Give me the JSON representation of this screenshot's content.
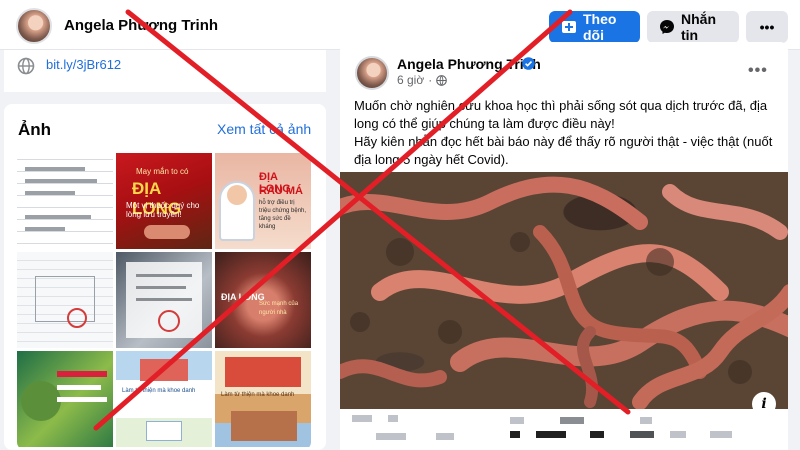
{
  "profile": {
    "name": "Angela Phương Trinh",
    "follow_label": "Theo dõi",
    "message_label": "Nhắn tin",
    "more_label": "•••"
  },
  "intro": {
    "link": "bit.ly/3jBr612"
  },
  "photos": {
    "title": "Ảnh",
    "see_all": "Xem tất cả ảnh",
    "tiles": [
      {
        "lines": []
      },
      {
        "heading": "ĐỊA LONG",
        "top": "May mắn to có",
        "sub": "Một vị thuốc quý cho lòng lưu truyền!"
      },
      {
        "heading": "ĐỊA LONG",
        "heading2": "RAU MÁ",
        "sub": "hỗ trợ điều trị triệu chứng bệnh, tăng sức đề kháng"
      },
      {
        "lines": []
      },
      {
        "lines": []
      },
      {
        "heading": "ĐỊA LONG",
        "sub": "Sức mạnh của người nhà"
      },
      {
        "lines": []
      },
      {
        "sub": "Làm từ thiện mà khoe danh"
      },
      {
        "sub": "Làm từ thiện mà khoe danh"
      }
    ]
  },
  "post": {
    "author": "Angela Phương Trinh",
    "time": "6 giờ",
    "text_lines": [
      "Muốn chờ nghiên cứu khoa học thì phải sống sót qua dịch trước đã, địa",
      "long có thể giúp chúng ta làm được điều này!",
      "Hãy kiên nhẫn đọc hết bài báo này để thấy rõ người thật - việc thật (nuốt",
      "địa long 5 ngày hết Covid)."
    ],
    "info_label": "i"
  },
  "colors": {
    "accent": "#1b74e4",
    "link": "#216fdb",
    "cross": "#e21e26",
    "bg": "#f0f2f5"
  },
  "icons": {
    "link": "globe-icon",
    "follow": "follow-icon",
    "message": "messenger-icon",
    "verified": "verified-badge-icon",
    "time": "public-audience-icon",
    "more": "more-options-icon",
    "info": "info-icon"
  }
}
